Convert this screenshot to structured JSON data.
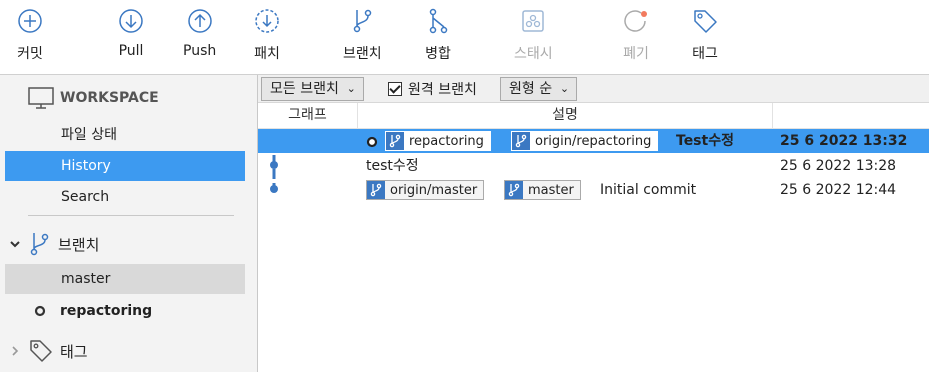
{
  "toolbar": {
    "commit": "커밋",
    "pull": "Pull",
    "push": "Push",
    "patch": "패치",
    "branch": "브랜치",
    "merge": "병합",
    "stash": "스태시",
    "discard": "폐기",
    "tag": "태그"
  },
  "sidebar": {
    "workspace": "WORKSPACE",
    "file_status": "파일 상태",
    "history": "History",
    "search": "Search",
    "branches": "브랜치",
    "branch_master": "master",
    "branch_current": "repactoring",
    "tags": "태그"
  },
  "filter": {
    "branch_filter": "모든 브랜치",
    "remote_branch": "원격 브랜치",
    "sort_order": "원형 순"
  },
  "columns": {
    "graph": "그래프",
    "description": "설명"
  },
  "commits": [
    {
      "refs": [
        "repactoring",
        "origin/repactoring"
      ],
      "message": "Test수정",
      "date": "25 6 2022 13:32"
    },
    {
      "refs": [],
      "message": "test수정",
      "date": "25 6 2022 13:28"
    },
    {
      "refs": [
        "origin/master",
        "master"
      ],
      "message": "Initial commit",
      "date": "25 6 2022 12:44"
    }
  ],
  "colors": {
    "accent": "#3d9af0",
    "branch_badge": "#3b78c2",
    "graph_line": "#3b78c2",
    "stash_dot": "#f27a5e"
  }
}
